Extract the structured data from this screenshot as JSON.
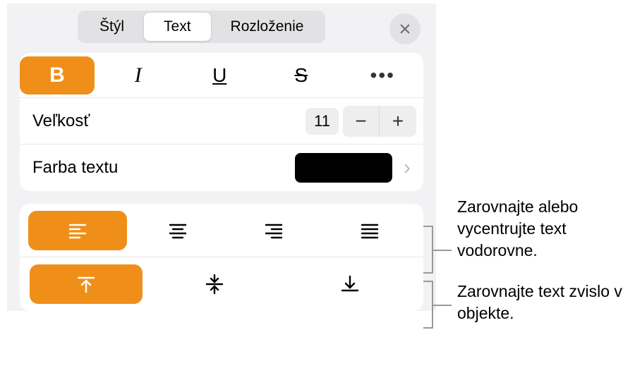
{
  "tabs": {
    "style": "Štýl",
    "text": "Text",
    "layout": "Rozloženie"
  },
  "format": {
    "bold": "B",
    "italic": "I",
    "underline": "U",
    "strikethrough": "S",
    "more": "•••"
  },
  "size": {
    "label": "Veľkosť",
    "value": "11",
    "minus": "−",
    "plus": "+"
  },
  "text_color": {
    "label": "Farba textu",
    "value": "#000000"
  },
  "callouts": {
    "horizontal": "Zarovnajte alebo vycentrujte text vodorovne.",
    "vertical": "Zarovnajte text zvislo v objekte."
  }
}
